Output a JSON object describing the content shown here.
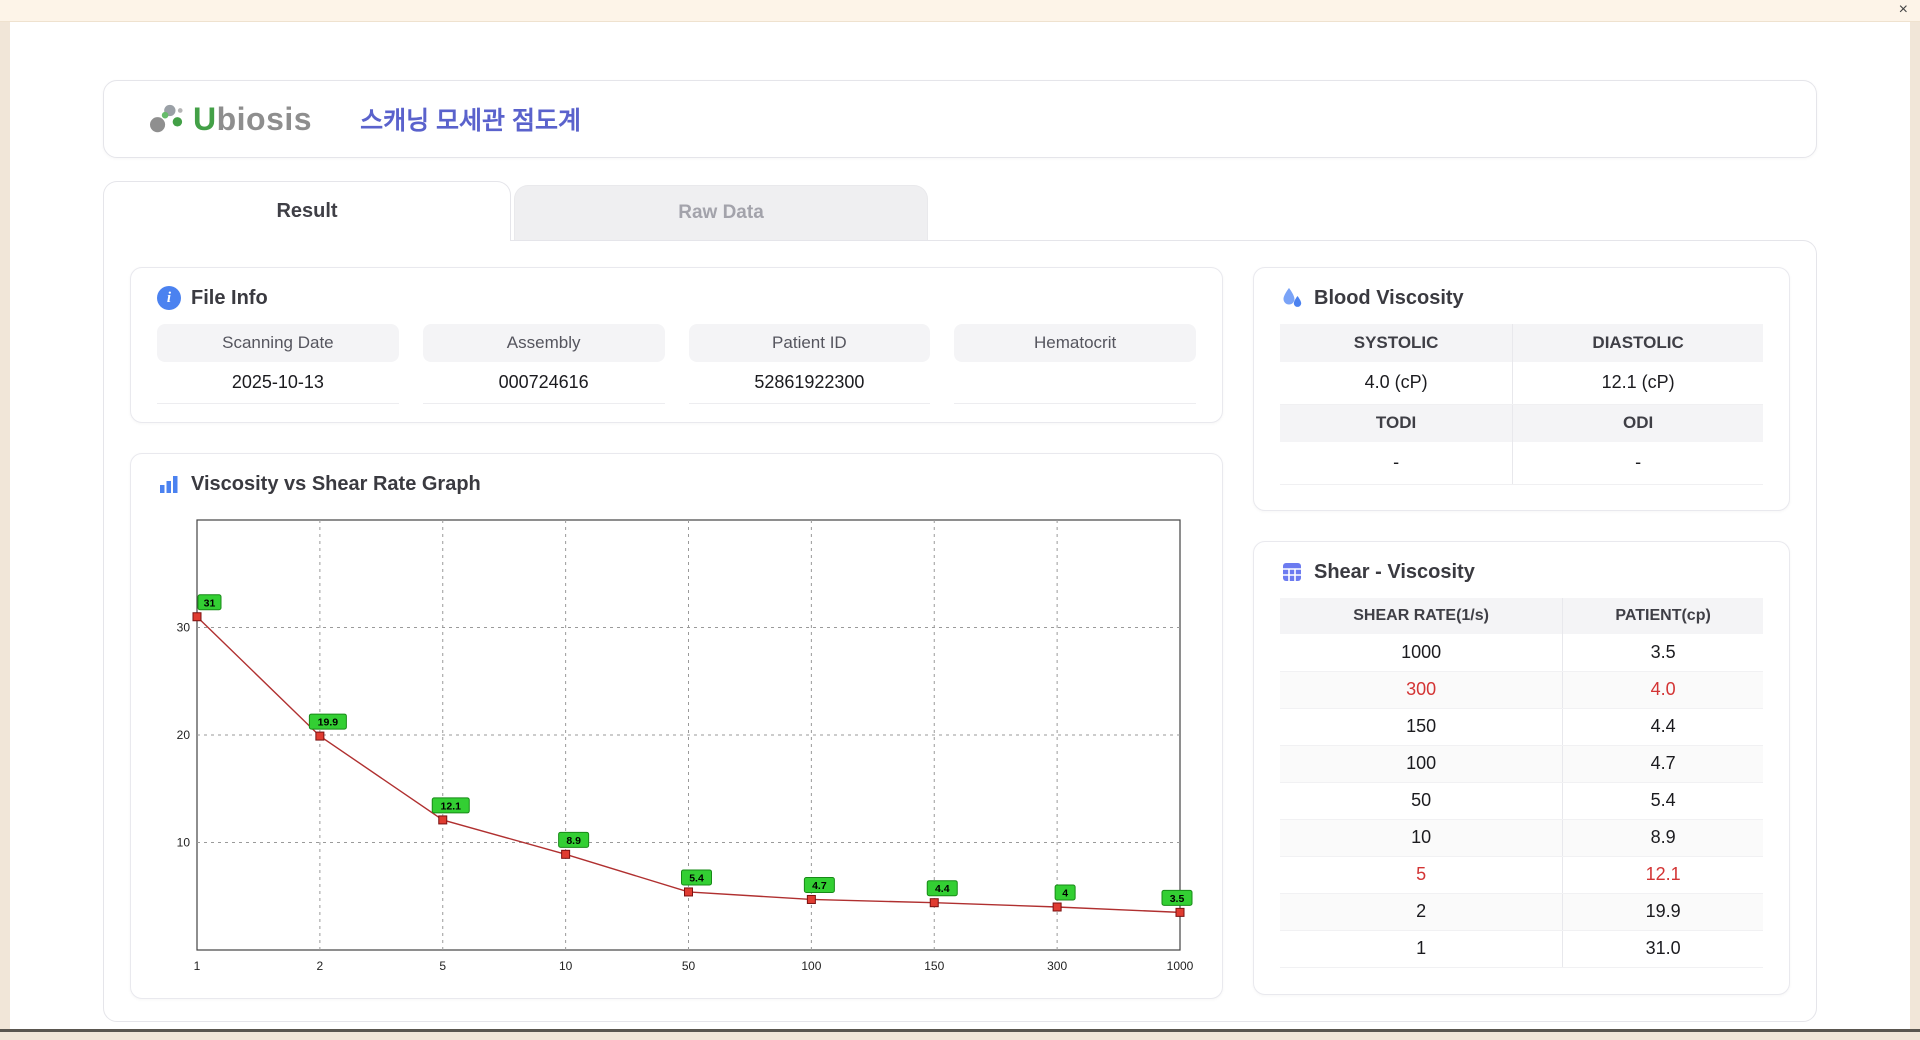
{
  "window": {
    "close_label": "×"
  },
  "header": {
    "logo_text_u": "U",
    "logo_text_rest": "biosis",
    "app_title_korean": "스캐닝 모세관 점도계"
  },
  "tabs": [
    {
      "label": "Result",
      "active": true
    },
    {
      "label": "Raw Data",
      "active": false
    }
  ],
  "file_info": {
    "title": "File Info",
    "fields": [
      {
        "label": "Scanning Date",
        "value": "2025-10-13"
      },
      {
        "label": "Assembly",
        "value": "000724616"
      },
      {
        "label": "Patient ID",
        "value": "52861922300"
      },
      {
        "label": "Hematocrit",
        "value": ""
      }
    ]
  },
  "graph": {
    "title": "Viscosity vs Shear Rate Graph"
  },
  "blood_viscosity": {
    "title": "Blood Viscosity",
    "systolic_label": "SYSTOLIC",
    "diastolic_label": "DIASTOLIC",
    "systolic_value": "4.0 (cP)",
    "diastolic_value": "12.1 (cP)",
    "todi_label": "TODI",
    "odi_label": "ODI",
    "todi_value": "-",
    "odi_value": "-"
  },
  "shear_viscosity": {
    "title": "Shear - Viscosity",
    "columns": [
      "SHEAR RATE(1/s)",
      "PATIENT(cp)"
    ],
    "rows": [
      {
        "rate": "1000",
        "patient": "3.5",
        "highlight": false
      },
      {
        "rate": "300",
        "patient": "4.0",
        "highlight": true
      },
      {
        "rate": "150",
        "patient": "4.4",
        "highlight": false
      },
      {
        "rate": "100",
        "patient": "4.7",
        "highlight": false
      },
      {
        "rate": "50",
        "patient": "5.4",
        "highlight": false
      },
      {
        "rate": "10",
        "patient": "8.9",
        "highlight": false
      },
      {
        "rate": "5",
        "patient": "12.1",
        "highlight": true
      },
      {
        "rate": "2",
        "patient": "19.9",
        "highlight": false
      },
      {
        "rate": "1",
        "patient": "31.0",
        "highlight": false
      }
    ]
  },
  "chart_data": {
    "type": "line",
    "title": "Viscosity vs Shear Rate Graph",
    "x_scale": "categorical",
    "categories": [
      "1",
      "2",
      "5",
      "10",
      "50",
      "100",
      "150",
      "300",
      "1000"
    ],
    "values": [
      31,
      19.9,
      12.1,
      8.9,
      5.4,
      4.7,
      4.4,
      4,
      3.5
    ],
    "point_labels": [
      "31",
      "19.9",
      "12.1",
      "8.9",
      "5.4",
      "4.7",
      "4.4",
      "4",
      "3.5"
    ],
    "xlabel": "",
    "ylabel": "",
    "ylim": [
      0,
      40
    ],
    "yticks": [
      10,
      20,
      30
    ],
    "grid": "dashed",
    "legend": "none",
    "line_color": "#b03030",
    "marker_color": "#e03c31",
    "marker_edge_color": "#7a1010",
    "label_badge_color": "#33cf33",
    "label_badge_edge_color": "#178a17"
  }
}
